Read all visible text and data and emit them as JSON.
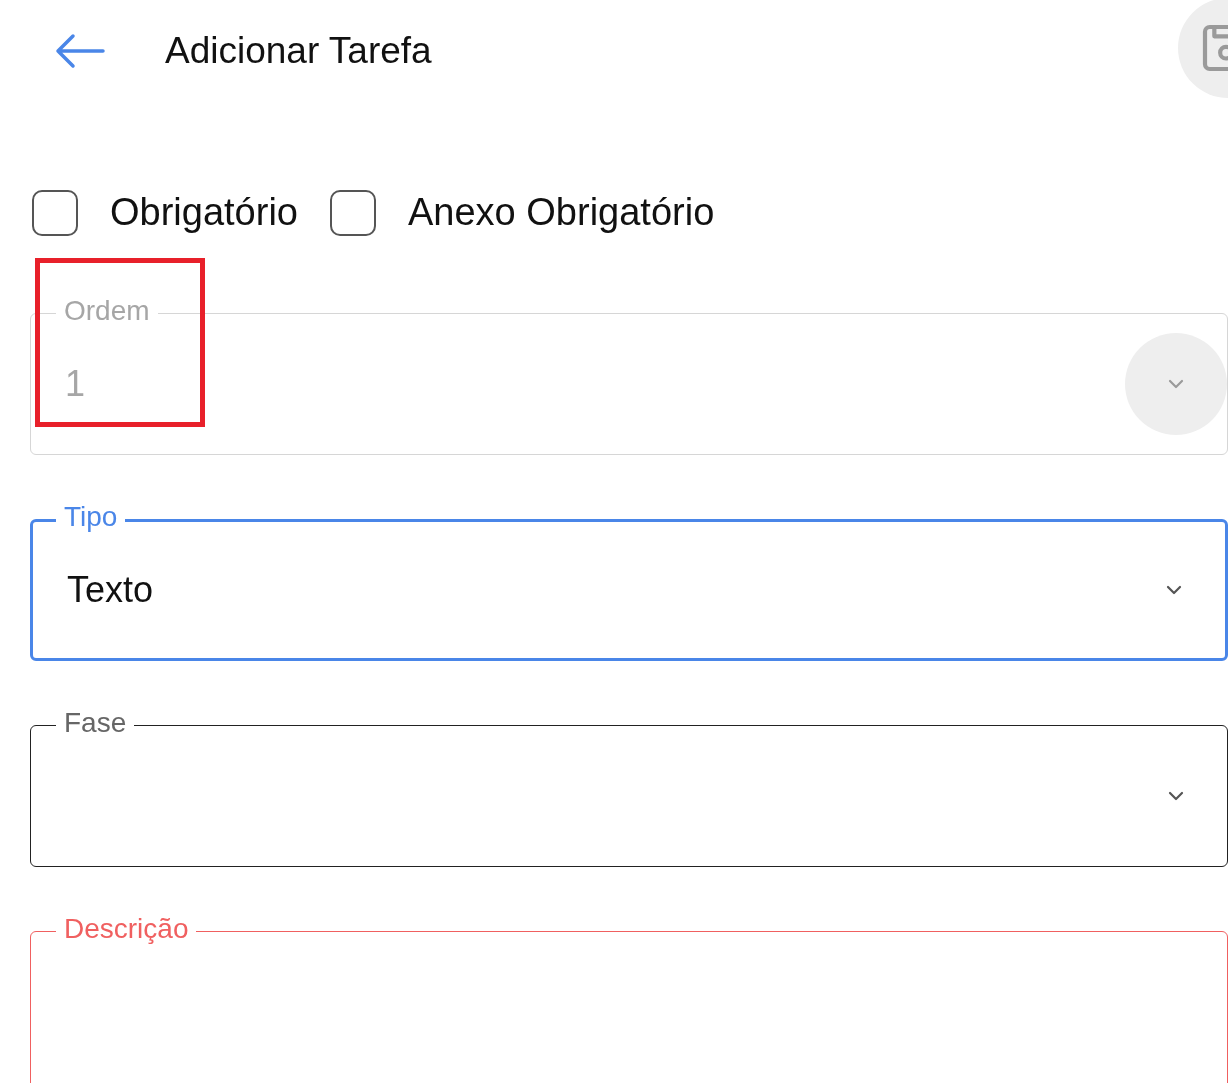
{
  "header": {
    "title": "Adicionar Tarefa"
  },
  "checkboxes": [
    {
      "label": "Obrigatório",
      "checked": false
    },
    {
      "label": "Anexo Obrigatório",
      "checked": false
    }
  ],
  "fields": [
    {
      "kind": "select",
      "label": "Ordem",
      "value": "1",
      "disabled": true,
      "focused": false,
      "error": false,
      "highlighted": true
    },
    {
      "kind": "select",
      "label": "Tipo",
      "value": "Texto",
      "disabled": false,
      "focused": true,
      "error": false
    },
    {
      "kind": "select",
      "label": "Fase",
      "disabled": false,
      "focused": false,
      "error": false
    },
    {
      "kind": "textarea",
      "label": "Descrição",
      "disabled": false,
      "focused": false,
      "error": true
    }
  ]
}
